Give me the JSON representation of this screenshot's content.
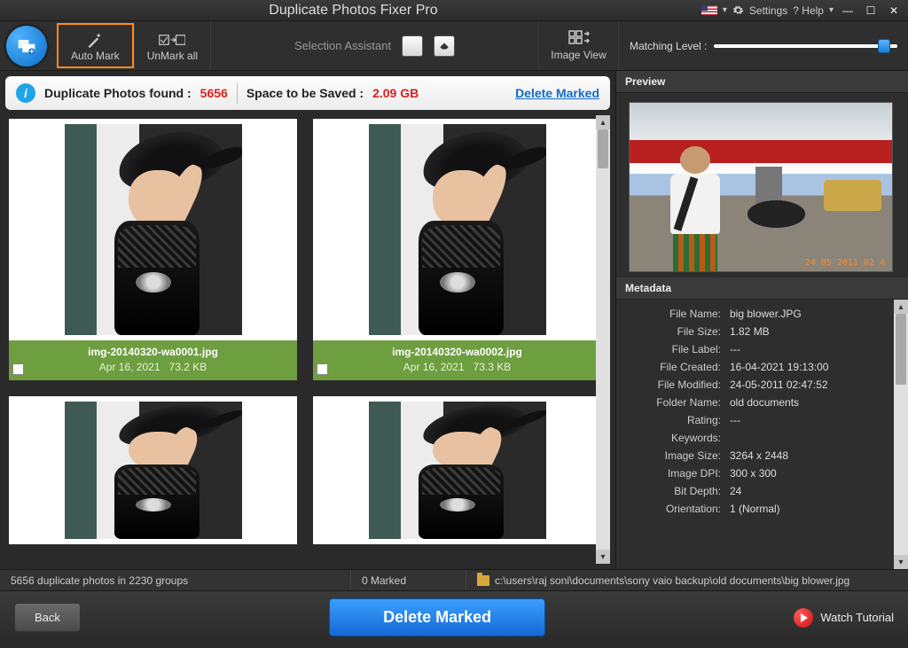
{
  "title": "Duplicate Photos Fixer Pro",
  "titlebar": {
    "settings": "Settings",
    "help": "? Help"
  },
  "toolbar": {
    "auto_mark": "Auto Mark",
    "unmark_all": "UnMark all",
    "selection_assistant": "Selection Assistant",
    "image_view": "Image View",
    "matching_level": "Matching Level :"
  },
  "infobar": {
    "found_label": "Duplicate Photos found :",
    "found_value": "5656",
    "saved_label": "Space to be Saved :",
    "saved_value": "2.09 GB",
    "delete_marked": "Delete Marked"
  },
  "cards": [
    {
      "filename": "img-20140320-wa0001.jpg",
      "date": "Apr 16, 2021",
      "size": "73.2 KB"
    },
    {
      "filename": "img-20140320-wa0002.jpg",
      "date": "Apr 16, 2021",
      "size": "73.3 KB"
    }
  ],
  "preview": {
    "header": "Preview",
    "stamp": "24 05 2011 02 4"
  },
  "metadata": {
    "header": "Metadata",
    "rows": [
      {
        "k": "File Name:",
        "v": "big blower.JPG"
      },
      {
        "k": "File Size:",
        "v": "1.82 MB"
      },
      {
        "k": "File Label:",
        "v": "---"
      },
      {
        "k": "File Created:",
        "v": "16-04-2021 19:13:00"
      },
      {
        "k": "File Modified:",
        "v": "24-05-2011 02:47:52"
      },
      {
        "k": "Folder Name:",
        "v": "old documents"
      },
      {
        "k": "Rating:",
        "v": "---"
      },
      {
        "k": "Keywords:",
        "v": ""
      },
      {
        "k": "Image Size:",
        "v": "3264 x 2448"
      },
      {
        "k": "Image DPI:",
        "v": "300 x 300"
      },
      {
        "k": "Bit Depth:",
        "v": "24"
      },
      {
        "k": "Orientation:",
        "v": "1 (Normal)"
      }
    ]
  },
  "status": {
    "dupes": "5656 duplicate photos in 2230 groups",
    "marked": "0 Marked",
    "path": "c:\\users\\raj soni\\documents\\sony vaio backup\\old documents\\big blower.jpg"
  },
  "bottom": {
    "back": "Back",
    "delete": "Delete Marked",
    "tutorial": "Watch Tutorial"
  }
}
